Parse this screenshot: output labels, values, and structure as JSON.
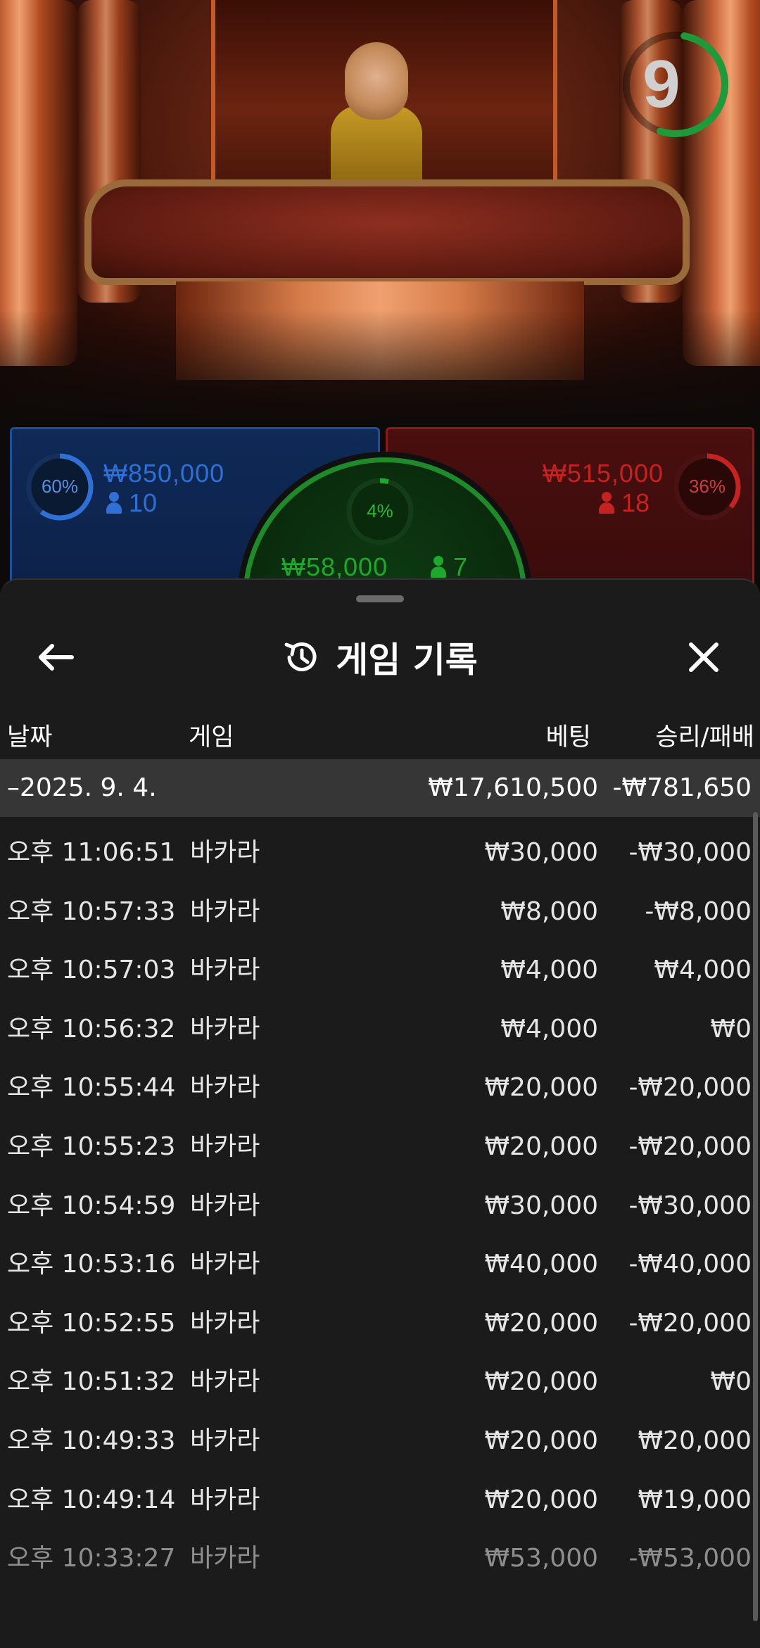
{
  "timer": {
    "value": "9",
    "ring_color": "#1f9a3a"
  },
  "bets": {
    "player": {
      "percent": "60%",
      "amount": "₩850,000",
      "players": "10",
      "color": "#2f6fd6"
    },
    "banker": {
      "percent": "36%",
      "amount": "₩515,000",
      "players": "18",
      "color": "#c52222"
    },
    "tie": {
      "percent": "4%",
      "amount": "₩58,000",
      "players": "7",
      "color": "#1ea82e"
    }
  },
  "sheet": {
    "title": "게임 기록",
    "back_icon": "arrow-left-icon",
    "history_icon": "history-icon",
    "close_icon": "close-icon",
    "columns": {
      "date": "날짜",
      "game": "게임",
      "bet": "베팅",
      "result": "승리/패배"
    },
    "summary": {
      "date": "–2025. 9. 4.",
      "bet": "₩17,610,500",
      "result": "-₩781,650"
    },
    "rows": [
      {
        "time": "오후 11:06:51",
        "game": "바카라",
        "bet": "₩30,000",
        "result": "-₩30,000"
      },
      {
        "time": "오후 10:57:33",
        "game": "바카라",
        "bet": "₩8,000",
        "result": "-₩8,000"
      },
      {
        "time": "오후 10:57:03",
        "game": "바카라",
        "bet": "₩4,000",
        "result": "₩4,000"
      },
      {
        "time": "오후 10:56:32",
        "game": "바카라",
        "bet": "₩4,000",
        "result": "₩0"
      },
      {
        "time": "오후 10:55:44",
        "game": "바카라",
        "bet": "₩20,000",
        "result": "-₩20,000"
      },
      {
        "time": "오후 10:55:23",
        "game": "바카라",
        "bet": "₩20,000",
        "result": "-₩20,000"
      },
      {
        "time": "오후 10:54:59",
        "game": "바카라",
        "bet": "₩30,000",
        "result": "-₩30,000"
      },
      {
        "time": "오후 10:53:16",
        "game": "바카라",
        "bet": "₩40,000",
        "result": "-₩40,000"
      },
      {
        "time": "오후 10:52:55",
        "game": "바카라",
        "bet": "₩20,000",
        "result": "-₩20,000"
      },
      {
        "time": "오후 10:51:32",
        "game": "바카라",
        "bet": "₩20,000",
        "result": "₩0"
      },
      {
        "time": "오후 10:49:33",
        "game": "바카라",
        "bet": "₩20,000",
        "result": "₩20,000"
      },
      {
        "time": "오후 10:49:14",
        "game": "바카라",
        "bet": "₩20,000",
        "result": "₩19,000"
      },
      {
        "time": "오후 10:33:27",
        "game": "바카라",
        "bet": "₩53,000",
        "result": "-₩53,000"
      }
    ]
  }
}
